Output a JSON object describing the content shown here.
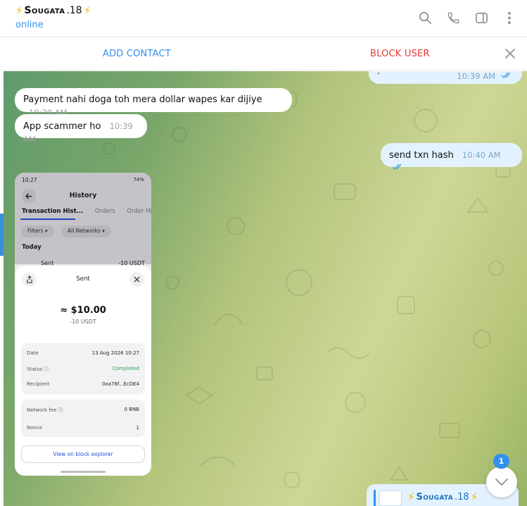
{
  "header": {
    "bolt_left": "⚡",
    "name": "Sougata",
    "name_suffix": ".18",
    "bolt_right": "⚡",
    "status": "online",
    "icons": [
      "search-icon",
      "phone-icon",
      "sidebar-toggle-icon",
      "more-vertical-icon"
    ]
  },
  "action_bar": {
    "add_contact": "ADD CONTACT",
    "block_user": "BLOCK USER",
    "close_icon": "close-icon"
  },
  "messages": {
    "m0_text": "·",
    "m0_time": "10:39 AM",
    "m1_text": "Payment nahi doga toh mera dollar wapes kar dijiye",
    "m1_time": "10:39 AM",
    "m2_text": "App scammer ho",
    "m2_time": "10:39 AM",
    "m3_text": "send txn hash",
    "m3_time": "10:40 AM"
  },
  "screenshot": {
    "status_time": "10:27",
    "status_right": "74%",
    "title": "History",
    "tab_active": "Transaction Hist...",
    "tab_orders": "Orders",
    "tab_order_hist": "Order Histo",
    "chip_filters": "Filters",
    "chip_networks": "All Networks",
    "today": "Today",
    "row_sent": "Sent",
    "row_amount": "-10 USDT",
    "sheet_title": "Sent",
    "amount": "≈ $10.00",
    "sub_amount": "-10 USDT",
    "date_label": "Date",
    "date_value": "13 Aug 2026 10:27",
    "status_label": "Status ⓘ",
    "status_value": "Completed",
    "recipient_label": "Recipient",
    "recipient_value": "0xa78f...EcDE4",
    "fee_label": "Network fee ⓘ",
    "fee_value": "0 BNB",
    "nonce_label": "Nonce",
    "nonce_value": "1",
    "explorer_button": "View on block explorer"
  },
  "preview": {
    "bolt_left": "⚡",
    "name": "Sougata",
    "name_suffix": ".18",
    "bolt_right": "⚡"
  },
  "scroll": {
    "unread_count": "1"
  },
  "colors": {
    "accent": "#3390ec",
    "danger": "#e53935",
    "outgoing_bubble": "#e3f2ff",
    "completed": "#23a04a"
  }
}
